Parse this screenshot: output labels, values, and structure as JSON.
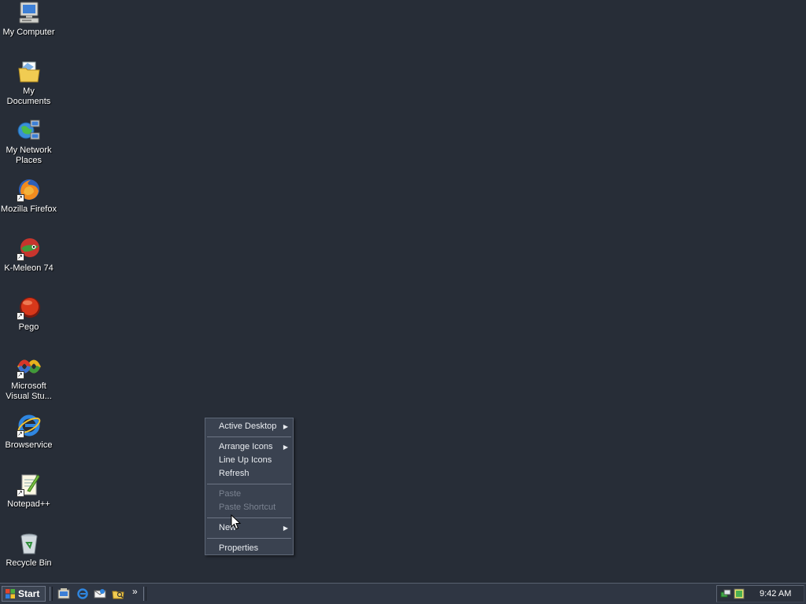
{
  "desktop": {
    "icons": [
      {
        "label_line1": "My Computer",
        "label_line2": ""
      },
      {
        "label_line1": "My Documents",
        "label_line2": ""
      },
      {
        "label_line1": "My Network",
        "label_line2": "Places"
      },
      {
        "label_line1": "Mozilla Firefox",
        "label_line2": ""
      },
      {
        "label_line1": "K-Meleon 74",
        "label_line2": ""
      },
      {
        "label_line1": "Pego",
        "label_line2": ""
      },
      {
        "label_line1": "Microsoft",
        "label_line2": "Visual Stu..."
      },
      {
        "label_line1": "Browservice",
        "label_line2": ""
      },
      {
        "label_line1": "Notepad++",
        "label_line2": ""
      },
      {
        "label_line1": "Recycle Bin",
        "label_line2": ""
      }
    ]
  },
  "context_menu": {
    "active_desktop": "Active Desktop",
    "arrange_icons": "Arrange Icons",
    "line_up_icons": "Line Up Icons",
    "refresh": "Refresh",
    "paste": "Paste",
    "paste_shortcut": "Paste Shortcut",
    "new": "New",
    "properties": "Properties",
    "submenu_arrow": "▶"
  },
  "taskbar": {
    "start_label": "Start",
    "quick_launch_more": "»",
    "clock": "9:42 AM"
  },
  "colors": {
    "desktop_background": "#272d37",
    "taskbar_background": "#2f3643",
    "menu_background": "#3a4250",
    "menu_disabled_text": "#7a8290"
  }
}
